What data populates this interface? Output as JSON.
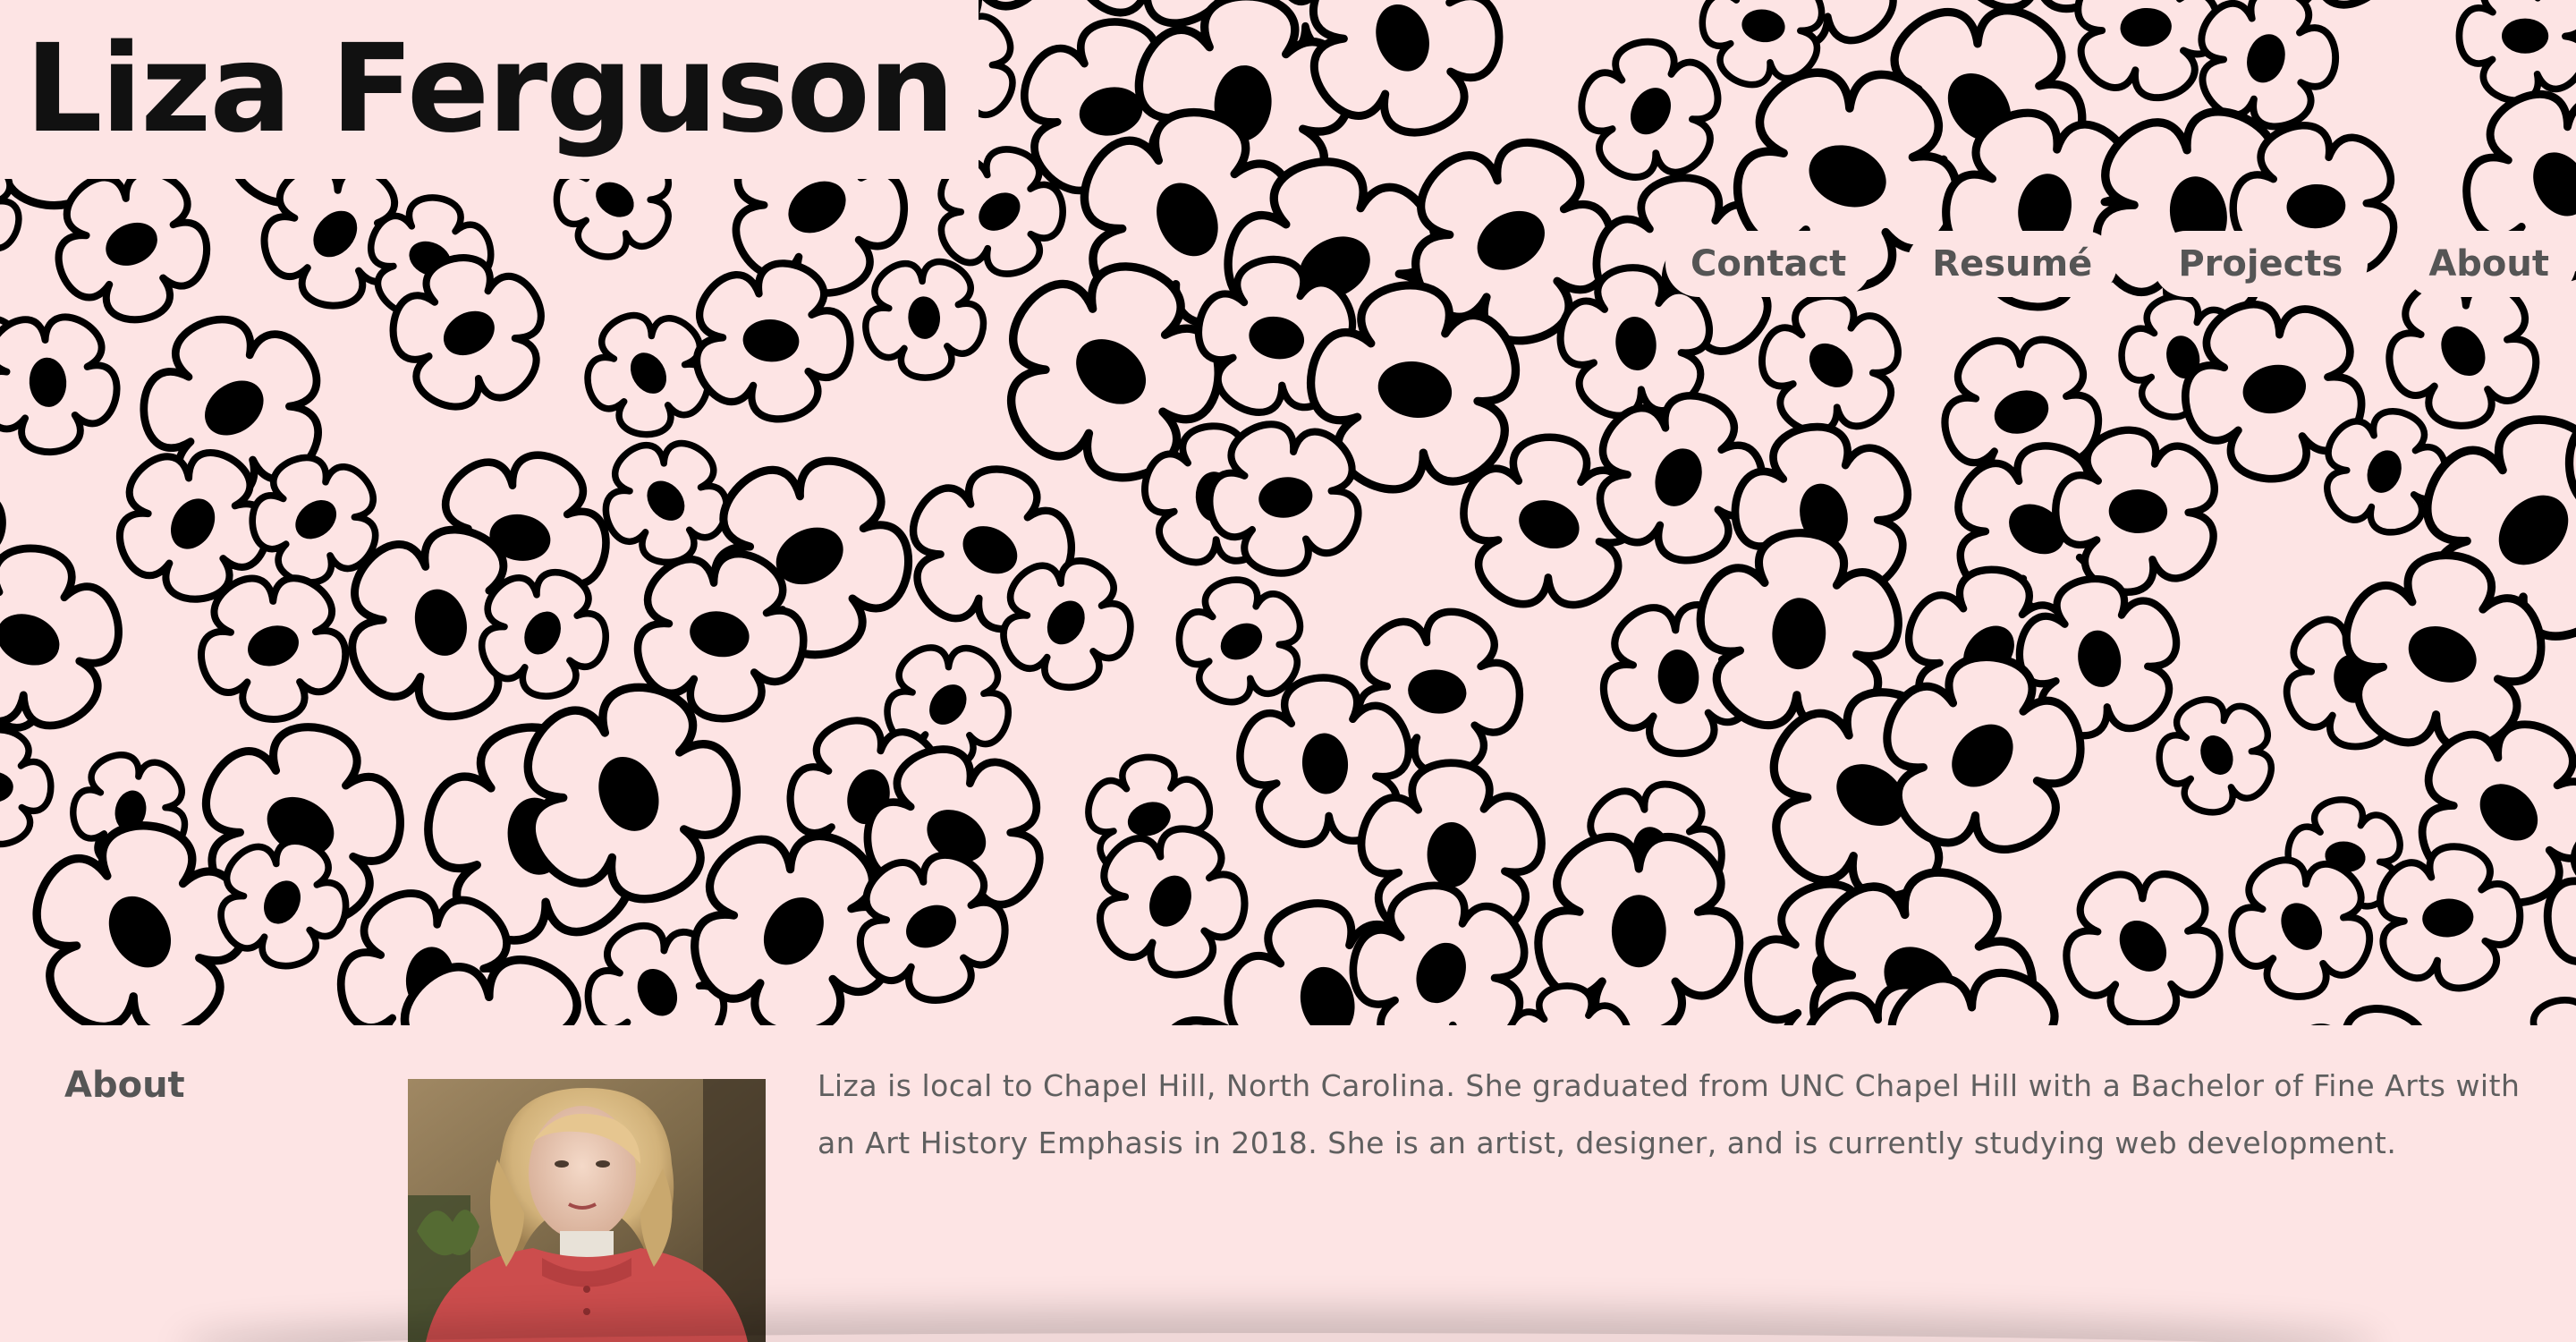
{
  "site": {
    "title": "Liza Ferguson"
  },
  "nav": {
    "items": [
      {
        "label": "Contact"
      },
      {
        "label": "Resumé"
      },
      {
        "label": "Projects"
      },
      {
        "label": "About"
      }
    ]
  },
  "about": {
    "heading": "About",
    "text": "Liza is local to Chapel Hill, North Carolina. She graduated from UNC Chapel Hill with a Bachelor of Fine Arts with an Art History Emphasis in 2018. She is an artist, designer, and is currently studying web development."
  },
  "colors": {
    "background": "#fde4e4",
    "title": "#111111",
    "nav_text": "#555555",
    "body_text": "#5f5f5f",
    "flower_outline": "#000000"
  },
  "icons": {
    "hero_pattern": "flower-pattern",
    "photo": "profile-photo"
  }
}
